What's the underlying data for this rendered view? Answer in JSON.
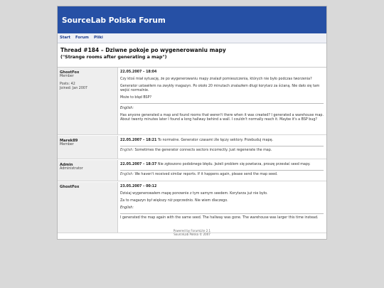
{
  "site": {
    "title": "SourceLab Polska Forum"
  },
  "nav": {
    "items": [
      "Start",
      "Forum",
      "Pliki"
    ]
  },
  "thread": {
    "title": "Thread #184 – Dziwne pokoje po wygenerowaniu mapy",
    "subtitle": "(\"Strange rooms after generating a map\")"
  },
  "posts": [
    {
      "author": "GhostFox",
      "role": "Member",
      "posts_label": "Posts: 42",
      "joined_label": "Joined: Jan 2007",
      "date": "22.05.2007 – 18:04",
      "pl1": "Czy ktoś miał sytuację, że po wygenerowaniu mapy znalazł pomieszczenia, których nie było podczas tworzenia?",
      "pl2": "Generator ustawiłem na zwykły magazyn. Po około 20 minutach znalazłem długi korytarz za ścianą. Nie dało się tam wejść normalnie.",
      "pl3": "Może to błąd BSP?",
      "en_label": "English:",
      "en": "Has anyone generated a map and found rooms that weren't there when it was created? I generated a warehouse map. About twenty minutes later I found a long hallway behind a wall. I couldn't normally reach it. Maybe it's a BSP bug?"
    },
    {
      "author": "Marek89",
      "role": "Member",
      "date": "22.05.2007 – 18:21",
      "pl": "To normalne. Generator czasami źle łączy sektory. Przebuduj mapę.",
      "en_label": "English:",
      "en": "Sometimes the generator connects sectors incorrectly. Just regenerate the map."
    },
    {
      "author": "Admin",
      "role": "Administrator",
      "date": "22.05.2007 – 18:37",
      "pl": "Nie zgłoszono podobnego błędu. Jeżeli problem się powtarza, proszę przesłać seed mapy.",
      "en_label": "English:",
      "en": "We haven't received similar reports. If it happens again, please send the map seed."
    },
    {
      "author": "GhostFox",
      "date": "23.05.2007 – 00:12",
      "pl1": "Dzisiaj wygenerowałem mapę ponownie z tym samym seedem. Korytarza już nie było.",
      "pl2": "Za to magazyn był większy niż poprzednio. Nie wiem dlaczego.",
      "en_label": "English:",
      "en": "I generated the map again with the same seed. The hallway was gone. The warehouse was larger this time instead."
    }
  ],
  "footer": {
    "line1": "Powered by ForumLite 2.1",
    "line2": "SourceLab Polska © 2007"
  }
}
